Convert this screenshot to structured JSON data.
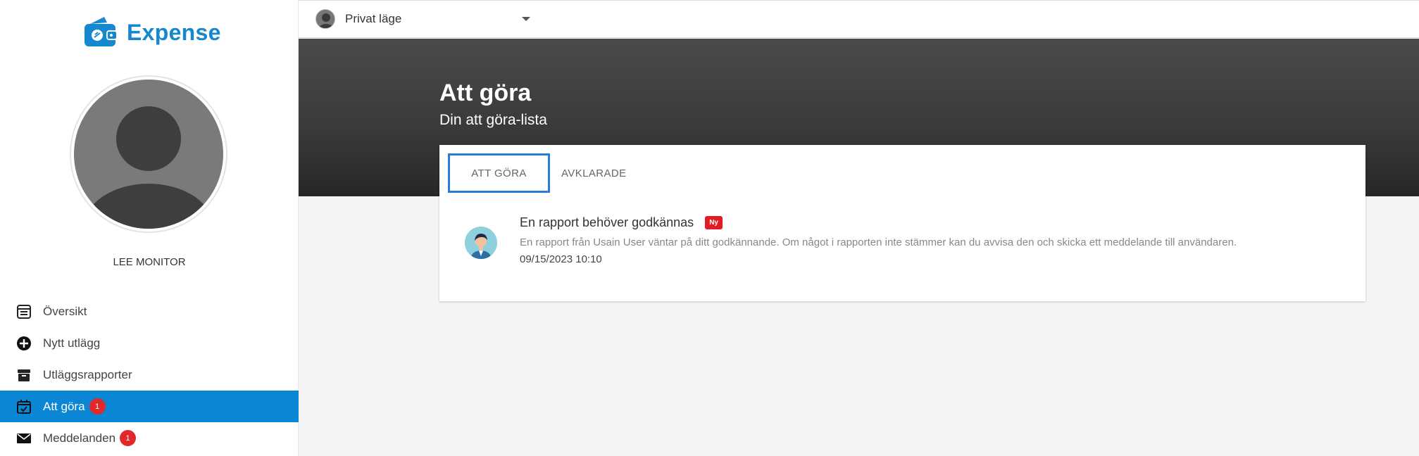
{
  "app": {
    "name": "Expense",
    "brand_color": "#1588cf"
  },
  "sidebar": {
    "user_name": "LEE MONITOR",
    "items": [
      {
        "label": "Översikt",
        "icon": "overview-icon",
        "active": false,
        "badge": null
      },
      {
        "label": "Nytt utlägg",
        "icon": "add-circle-icon",
        "active": false,
        "badge": null
      },
      {
        "label": "Utläggsrapporter",
        "icon": "archive-icon",
        "active": false,
        "badge": null
      },
      {
        "label": "Att göra",
        "icon": "calendar-check-icon",
        "active": true,
        "badge": "1"
      },
      {
        "label": "Meddelanden",
        "icon": "mail-icon",
        "active": false,
        "badge": "1"
      }
    ],
    "active_color": "#0a86d4",
    "badge_color": "#e0292b"
  },
  "topbar": {
    "mode_label": "Privat läge"
  },
  "hero": {
    "title": "Att göra",
    "subtitle": "Din att göra-lista"
  },
  "tabs": [
    {
      "label": "ATT GÖRA",
      "selected": true
    },
    {
      "label": "AVKLARADE",
      "selected": false
    }
  ],
  "todos": [
    {
      "title": "En rapport behöver godkännas",
      "tag": "Ny",
      "description": "En rapport från Usain User väntar på ditt godkännande. Om något i rapporten inte stämmer kan du avvisa den och skicka ett meddelande till användaren.",
      "date": "09/15/2023 10:10"
    }
  ]
}
